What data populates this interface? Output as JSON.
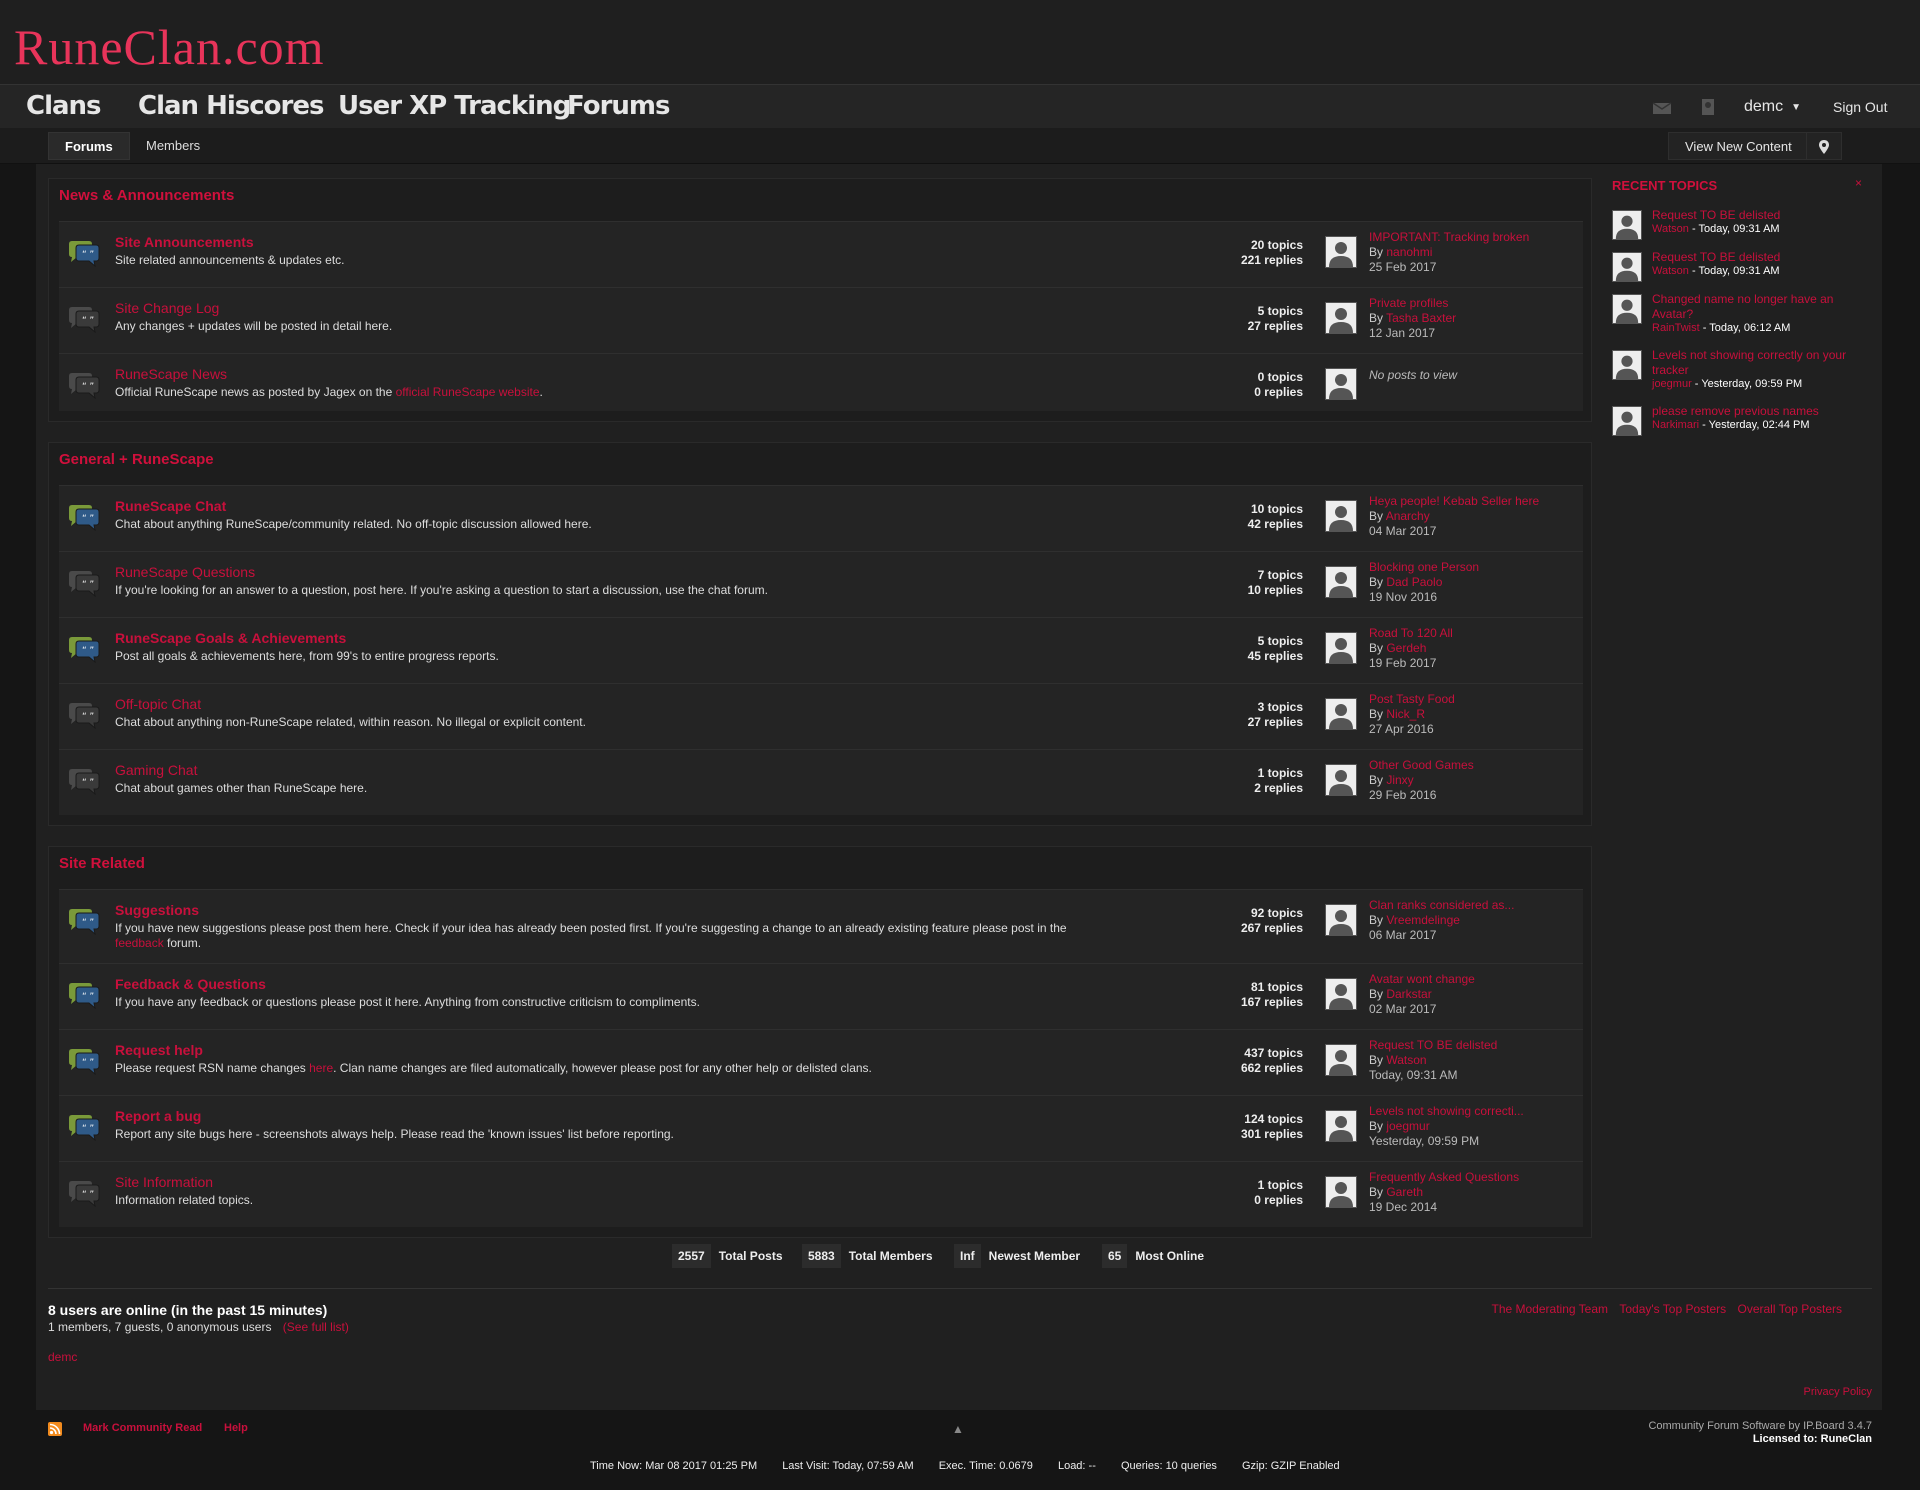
{
  "header": {
    "logo": "RuneClan.com"
  },
  "nav": {
    "items": [
      "Clans",
      "Clan Hiscores",
      "User XP Tracking",
      "Forums"
    ],
    "user": "demc",
    "sign_out": "Sign Out"
  },
  "subnav": {
    "tabs": [
      "Forums",
      "Members"
    ],
    "view_new": "View New Content"
  },
  "categories": [
    {
      "title": "News & Announcements",
      "forums": [
        {
          "name": "Site Announcements",
          "desc": "Site related announcements & updates etc.",
          "topics": "20 topics",
          "replies": "221 replies",
          "last_title": "IMPORTANT: Tracking broken",
          "by": "By ",
          "last_by": "nanohmi",
          "last_date": "25 Feb 2017",
          "unread": true
        },
        {
          "name": "Site Change Log",
          "desc": "Any changes + updates will be posted in detail here.",
          "topics": "5 topics",
          "replies": "27 replies",
          "last_title": "Private profiles",
          "by": "By ",
          "last_by": "Tasha Baxter",
          "last_date": "12 Jan 2017",
          "unread": false
        },
        {
          "name": "RuneScape News",
          "desc_pre": "Official RuneScape news as posted by Jagex on the ",
          "desc_link": "official RuneScape website",
          "desc_post": ".",
          "topics": "0 topics",
          "replies": "0 replies",
          "no_posts": "No posts to view",
          "unread": false
        }
      ]
    },
    {
      "title": "General + RuneScape",
      "forums": [
        {
          "name": "RuneScape Chat",
          "desc": "Chat about anything RuneScape/community related. No off-topic discussion allowed here.",
          "topics": "10 topics",
          "replies": "42 replies",
          "last_title": "Heya people! Kebab Seller here",
          "by": "By ",
          "last_by": "Anarchy",
          "last_date": "04 Mar 2017",
          "unread": true
        },
        {
          "name": "RuneScape Questions",
          "desc": "If you're looking for an answer to a question, post here. If you're asking a question to start a discussion, use the chat forum.",
          "topics": "7 topics",
          "replies": "10 replies",
          "last_title": "Blocking one Person",
          "by": "By ",
          "last_by": "Dad Paolo",
          "last_date": "19 Nov 2016",
          "unread": false
        },
        {
          "name": "RuneScape Goals & Achievements",
          "desc": "Post all goals & achievements here, from 99's to entire progress reports.",
          "topics": "5 topics",
          "replies": "45 replies",
          "last_title": "Road To 120 All",
          "by": "By ",
          "last_by": "Gerdeh",
          "last_date": "19 Feb 2017",
          "unread": true
        },
        {
          "name": "Off-topic Chat",
          "desc": "Chat about anything non-RuneScape related, within reason. No illegal or explicit content.",
          "topics": "3 topics",
          "replies": "27 replies",
          "last_title": "Post Tasty Food",
          "by": "By ",
          "last_by": "Nick_R",
          "last_date": "27 Apr 2016",
          "unread": false
        },
        {
          "name": "Gaming Chat",
          "desc": "Chat about games other than RuneScape here.",
          "topics": "1 topics",
          "replies": "2 replies",
          "last_title": "Other Good Games",
          "by": "By ",
          "last_by": "Jinxy",
          "last_date": "29 Feb 2016",
          "unread": false
        }
      ]
    },
    {
      "title": "Site Related",
      "forums": [
        {
          "name": "Suggestions",
          "desc_pre": "If you have new suggestions please post them here. Check if your idea has already been posted first. If you're suggesting a change to an already existing feature please post in the ",
          "desc_link": "feedback",
          "desc_post": " forum.",
          "topics": "92 topics",
          "replies": "267 replies",
          "last_title": "Clan ranks considered as...",
          "by": "By ",
          "last_by": "Vreemdelinge",
          "last_date": "06 Mar 2017",
          "unread": true
        },
        {
          "name": "Feedback & Questions",
          "desc": "If you have any feedback or questions please post it here. Anything from constructive criticism to compliments.",
          "topics": "81 topics",
          "replies": "167 replies",
          "last_title": "Avatar wont change",
          "by": "By ",
          "last_by": "Darkstar",
          "last_date": "02 Mar 2017",
          "unread": true
        },
        {
          "name": "Request help",
          "desc_pre": "Please request RSN name changes ",
          "desc_link": "here",
          "desc_post": ". Clan name changes are filed automatically, however please post for any other help or delisted clans.",
          "topics": "437 topics",
          "replies": "662 replies",
          "last_title": "Request TO BE delisted",
          "by": "By ",
          "last_by": "Watson",
          "last_date": "Today, 09:31 AM",
          "unread": true
        },
        {
          "name": "Report a bug",
          "desc": "Report any site bugs here - screenshots always help. Please read the 'known issues' list before reporting.",
          "topics": "124 topics",
          "replies": "301 replies",
          "last_title": "Levels not showing correcti...",
          "by": "By ",
          "last_by": "joegmur",
          "last_date": "Yesterday, 09:59 PM",
          "unread": true
        },
        {
          "name": "Site Information",
          "desc": "Information related topics.",
          "topics": "1 topics",
          "replies": "0 replies",
          "last_title": "Frequently Asked Questions",
          "by": "By ",
          "last_by": "Gareth",
          "last_date": "19 Dec 2014",
          "unread": false
        }
      ]
    }
  ],
  "recent": {
    "title": "RECENT TOPICS",
    "close": "×",
    "items": [
      {
        "title": "Request TO BE delisted",
        "user": "Watson",
        "time": " - Today, 09:31 AM"
      },
      {
        "title": "Request TO BE delisted",
        "user": "Watson",
        "time": " - Today, 09:31 AM"
      },
      {
        "title": "Changed name no longer have an Avatar?",
        "user": "RainTwist",
        "time": " - Today, 06:12 AM"
      },
      {
        "title": "Levels not showing correctly on your tracker",
        "user": "joegmur",
        "time": " - Yesterday, 09:59 PM"
      },
      {
        "title": "please remove previous names",
        "user": "Narkimari",
        "time": " - Yesterday, 02:44 PM"
      }
    ]
  },
  "board_stats": [
    {
      "num": "2557",
      "label": "Total Posts"
    },
    {
      "num": "5883",
      "label": "Total Members"
    },
    {
      "num": "Inf",
      "label": "Newest Member"
    },
    {
      "num": "65",
      "label": "Most Online"
    }
  ],
  "online": {
    "title": "8 users are online (in the past 15 minutes)",
    "sub": "1 members, 7 guests, 0 anonymous users",
    "see_full": "(See full list)",
    "user": "demc",
    "links": [
      "The Moderating Team",
      "Today's Top Posters",
      "Overall Top Posters"
    ],
    "privacy": "Privacy Policy"
  },
  "footer": {
    "mark_read": "Mark Community Read",
    "help": "Help",
    "up": "▲",
    "software": "Community Forum Software by IP.Board 3.4.7",
    "licensed": "Licensed to: RuneClan",
    "time_now": "Time Now: Mar 08 2017 01:25 PM",
    "last_visit": "Last Visit: Today, 07:59 AM",
    "exec": "Exec. Time: 0.0679",
    "load": "Load: --",
    "queries": "Queries: 10 queries",
    "gzip": "Gzip: GZIP Enabled"
  },
  "colors": {
    "accent": "#c8103c",
    "background": "#151515",
    "panel": "#202020",
    "row": "#242424"
  }
}
